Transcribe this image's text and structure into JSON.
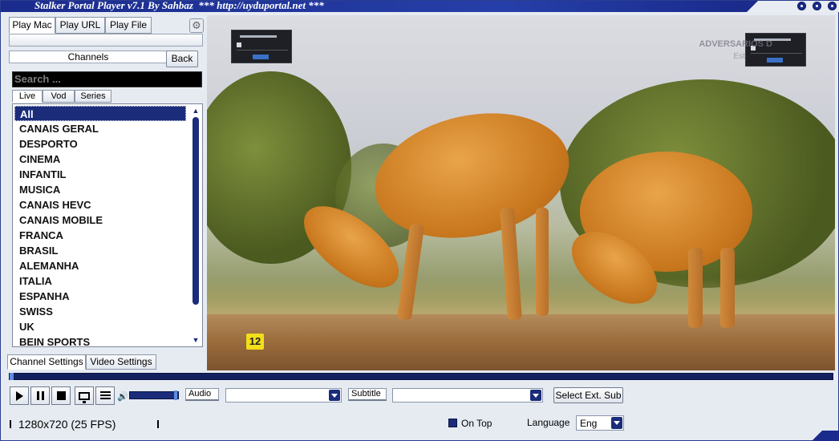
{
  "window": {
    "title": "Stalker Portal Player v7.1 By Sahbaz",
    "subtitle": "*** http://uyduportal.net ***"
  },
  "top_tabs": [
    "Play Mac",
    "Play URL",
    "Play File"
  ],
  "channels_label": "Channels",
  "back_label": "Back",
  "search": {
    "placeholder": "Search ..."
  },
  "list_tabs": [
    "Live",
    "Vod",
    "Series"
  ],
  "categories": [
    "All",
    "CANAIS GERAL",
    "DESPORTO",
    "CINEMA",
    "INFANTIL",
    "MUSICA",
    "CANAIS HEVC",
    "CANAIS MOBILE",
    "FRANCA",
    "BRASIL",
    "ALEMANHA",
    "ITALIA",
    "ESPANHA",
    "SWISS",
    "UK",
    "BEIN SPORTS"
  ],
  "selected_category": "All",
  "bottom_tabs": [
    "Channel Settings",
    "Video Settings"
  ],
  "video": {
    "rating": "12",
    "channel_logo": "ADVERSARIOS D",
    "channel_logo_sub": "Est"
  },
  "controls": {
    "audio_label": "Audio",
    "subtitle_label": "Subtitle",
    "select_ext_sub": "Select Ext. Sub",
    "audio_value": "",
    "subtitle_value": ""
  },
  "status": {
    "resolution": "1280x720   (25 FPS)",
    "on_top": "On Top",
    "language_label": "Language",
    "language_value": "Eng"
  },
  "colors": {
    "accent": "#1a2c7a",
    "titlebar": "#1a2b8c"
  }
}
